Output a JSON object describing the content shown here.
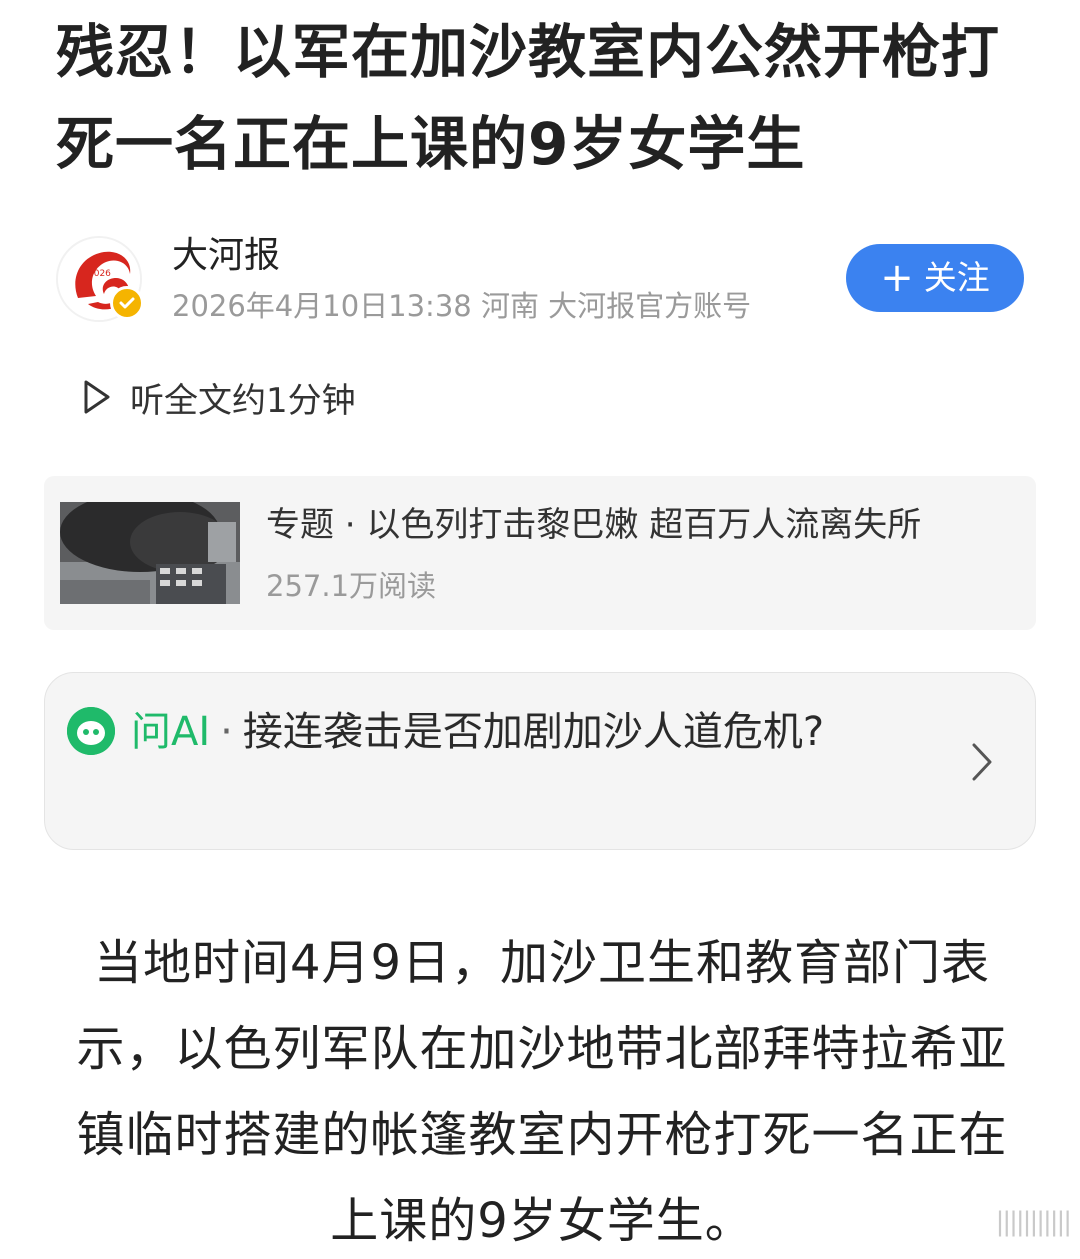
{
  "article": {
    "title": "残忍！以军在加沙教室内公然开枪打死一名正在上课的9岁女学生"
  },
  "author": {
    "name": "大河报",
    "meta": "2026年4月10日13:38 河南 大河报官方账号",
    "avatar_text": "2026",
    "follow_plus": "+",
    "follow_label": "关注"
  },
  "listen": {
    "label": "听全文约1分钟"
  },
  "topic": {
    "title": "专题 · 以色列打击黎巴嫩 超百万人流离失所",
    "reads": "257.1万阅读"
  },
  "ask_ai": {
    "label": "问AI",
    "separator": "·",
    "question": "接连袭击是否加剧加沙人道危机?"
  },
  "body": {
    "paragraph": "当地时间4月9日，加沙卫生和教育部门表示，以色列军队在加沙地带北部拜特拉希亚镇临时搭建的帐篷教室内开枪打死一名正在上课的9岁女学生。"
  },
  "watermark": "|||||||||||",
  "colors": {
    "accent_blue": "#3b82f0",
    "ai_green": "#1fba6a",
    "verified_gold": "#f5b400",
    "brand_red": "#d7261e",
    "muted_text": "#9a9a9a",
    "card_bg": "#f5f5f5"
  },
  "icons": [
    "verified-badge-icon",
    "play-icon",
    "ai-assistant-icon",
    "chevron-right-icon"
  ]
}
